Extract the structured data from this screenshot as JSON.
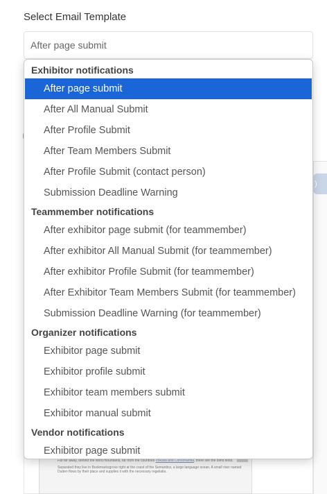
{
  "form": {
    "label": "Select Email Template",
    "selected_value": "After page submit"
  },
  "dropdown": {
    "groups": [
      {
        "label": "Exhibitor notifications",
        "options": [
          {
            "label": "After page submit",
            "selected": true
          },
          {
            "label": "After All Manual Submit"
          },
          {
            "label": "After Profile Submit"
          },
          {
            "label": "After Team Members Submit"
          },
          {
            "label": "After Profile Submit (contact person)"
          },
          {
            "label": "Submission Deadline Warning"
          }
        ]
      },
      {
        "label": "Teammember notifications",
        "options": [
          {
            "label": "After exhibitor page submit (for teammember)"
          },
          {
            "label": "After exhibitor All Manual Submit (for teammember)"
          },
          {
            "label": "After exhibitor Profile Submit (for teammember)"
          },
          {
            "label": "After Exhibitor Team Members Submit (for teammember)"
          },
          {
            "label": "Submission Deadline Warning (for teammember)"
          }
        ]
      },
      {
        "label": "Organizer notifications",
        "options": [
          {
            "label": "Exhibitor page submit"
          },
          {
            "label": "Exhibitor profile submit"
          },
          {
            "label": "Exhibitor team members submit"
          },
          {
            "label": "Exhibitor manual submit"
          }
        ]
      },
      {
        "label": "Vendor notifications",
        "options": [
          {
            "label": "Exhibitor page submit"
          }
        ]
      }
    ]
  },
  "preview": {
    "line1": "Far far away, behind the word mountains, far from the countries",
    "line1_link": "Vokalia and Consonantia",
    "line2": "there live the blind texts.",
    "line3": "Separated they live in Bookmarksgrove right at the coast of the Semantics, a large language ocean. A small river named Duden flows by their place and supplies it with the necessary regelialia."
  },
  "colors": {
    "selected_bg": "#1a66d9",
    "selected_text": "#ffffff"
  }
}
